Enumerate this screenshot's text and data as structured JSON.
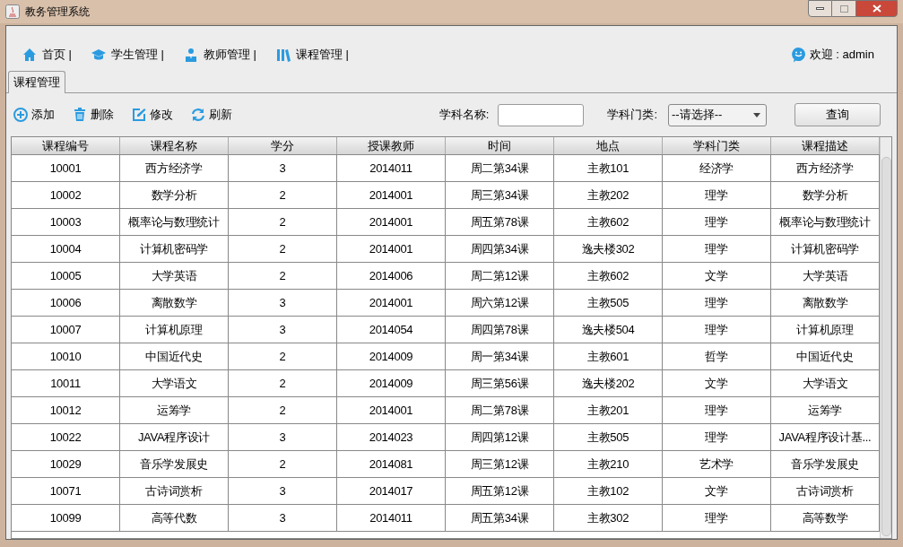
{
  "window": {
    "title": "教务管理系统"
  },
  "nav": [
    {
      "label": "首页 |",
      "kind": "home"
    },
    {
      "label": "学生管理 |",
      "kind": "students"
    },
    {
      "label": "教师管理 |",
      "kind": "teachers"
    },
    {
      "label": "课程管理 |",
      "kind": "courses"
    }
  ],
  "welcome": "欢迎 : admin",
  "tabs": [
    {
      "label": "课程管理",
      "selected": true
    }
  ],
  "toolbar": [
    {
      "label": "添加",
      "kind": "add"
    },
    {
      "label": "删除",
      "kind": "delete"
    },
    {
      "label": "修改",
      "kind": "edit"
    },
    {
      "label": "刷新",
      "kind": "refresh"
    }
  ],
  "filters": {
    "name_label": "学科名称:",
    "category_label": "学科门类:",
    "category_value": "--请选择--",
    "query_button": "查询"
  },
  "table": {
    "columns": [
      "课程编号",
      "课程名称",
      "学分",
      "授课教师",
      "时间",
      "地点",
      "学科门类",
      "课程描述"
    ],
    "rows": [
      [
        "10001",
        "西方经济学",
        "3",
        "2014011",
        "周二第34课",
        "主教101",
        "经济学",
        "西方经济学"
      ],
      [
        "10002",
        "数学分析",
        "2",
        "2014001",
        "周三第34课",
        "主教202",
        "理学",
        "数学分析"
      ],
      [
        "10003",
        "概率论与数理统计",
        "2",
        "2014001",
        "周五第78课",
        "主教602",
        "理学",
        "概率论与数理统计"
      ],
      [
        "10004",
        "计算机密码学",
        "2",
        "2014001",
        "周四第34课",
        "逸夫楼302",
        "理学",
        "计算机密码学"
      ],
      [
        "10005",
        "大学英语",
        "2",
        "2014006",
        "周二第12课",
        "主教602",
        "文学",
        "大学英语"
      ],
      [
        "10006",
        "离散数学",
        "3",
        "2014001",
        "周六第12课",
        "主教505",
        "理学",
        "离散数学"
      ],
      [
        "10007",
        "计算机原理",
        "3",
        "2014054",
        "周四第78课",
        "逸夫楼504",
        "理学",
        "计算机原理"
      ],
      [
        "10010",
        "中国近代史",
        "2",
        "2014009",
        "周一第34课",
        "主教601",
        "哲学",
        "中国近代史"
      ],
      [
        "10011",
        "大学语文",
        "2",
        "2014009",
        "周三第56课",
        "逸夫楼202",
        "文学",
        "大学语文"
      ],
      [
        "10012",
        "运筹学",
        "2",
        "2014001",
        "周二第78课",
        "主教201",
        "理学",
        "运筹学"
      ],
      [
        "10022",
        "JAVA程序设计",
        "3",
        "2014023",
        "周四第12课",
        "主教505",
        "理学",
        "JAVA程序设计基..."
      ],
      [
        "10029",
        "音乐学发展史",
        "2",
        "2014081",
        "周三第12课",
        "主教210",
        "艺术学",
        "音乐学发展史"
      ],
      [
        "10071",
        "古诗词赏析",
        "3",
        "2014017",
        "周五第12课",
        "主教102",
        "文学",
        "古诗词赏析"
      ],
      [
        "10099",
        "高等代数",
        "3",
        "2014011",
        "周五第34课",
        "主教302",
        "理学",
        "高等数学"
      ]
    ]
  }
}
